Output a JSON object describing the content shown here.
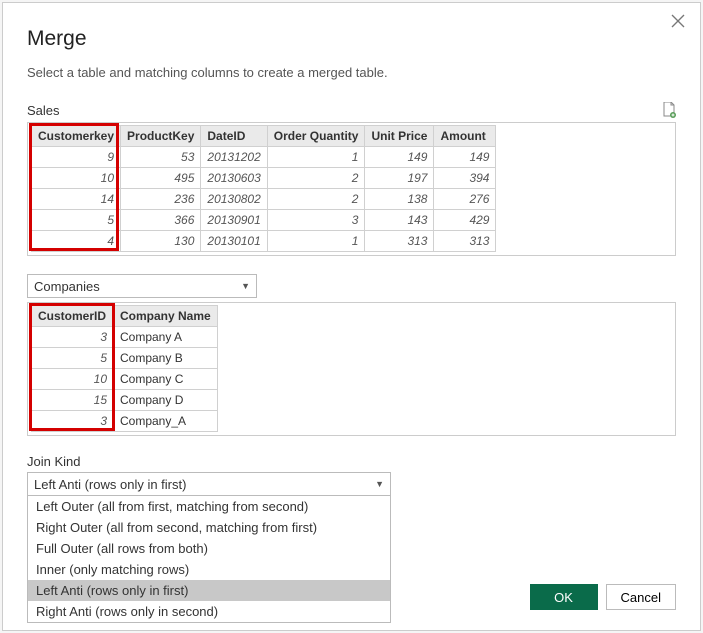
{
  "dialog": {
    "title": "Merge",
    "subtitle": "Select a table and matching columns to create a merged table."
  },
  "table1": {
    "name": "Sales",
    "headers": [
      "Customerkey",
      "ProductKey",
      "DateID",
      "Order Quantity",
      "Unit Price",
      "Amount"
    ],
    "rows": [
      [
        "9",
        "53",
        "20131202",
        "1",
        "149",
        "149"
      ],
      [
        "10",
        "495",
        "20130603",
        "2",
        "197",
        "394"
      ],
      [
        "14",
        "236",
        "20130802",
        "2",
        "138",
        "276"
      ],
      [
        "5",
        "366",
        "20130901",
        "3",
        "143",
        "429"
      ],
      [
        "4",
        "130",
        "20130101",
        "1",
        "313",
        "313"
      ]
    ]
  },
  "table2": {
    "selected": "Companies",
    "headers": [
      "CustomerID",
      "Company Name"
    ],
    "rows": [
      [
        "3",
        "Company A"
      ],
      [
        "5",
        "Company B"
      ],
      [
        "10",
        "Company C"
      ],
      [
        "15",
        "Company D"
      ],
      [
        "3",
        "Company_A"
      ]
    ]
  },
  "joinKind": {
    "label": "Join Kind",
    "selected": "Left Anti (rows only in first)",
    "options": [
      "Left Outer (all from first, matching from second)",
      "Right Outer (all from second, matching from first)",
      "Full Outer (all rows from both)",
      "Inner (only matching rows)",
      "Left Anti (rows only in first)",
      "Right Anti (rows only in second)"
    ]
  },
  "buttons": {
    "ok": "OK",
    "cancel": "Cancel"
  }
}
